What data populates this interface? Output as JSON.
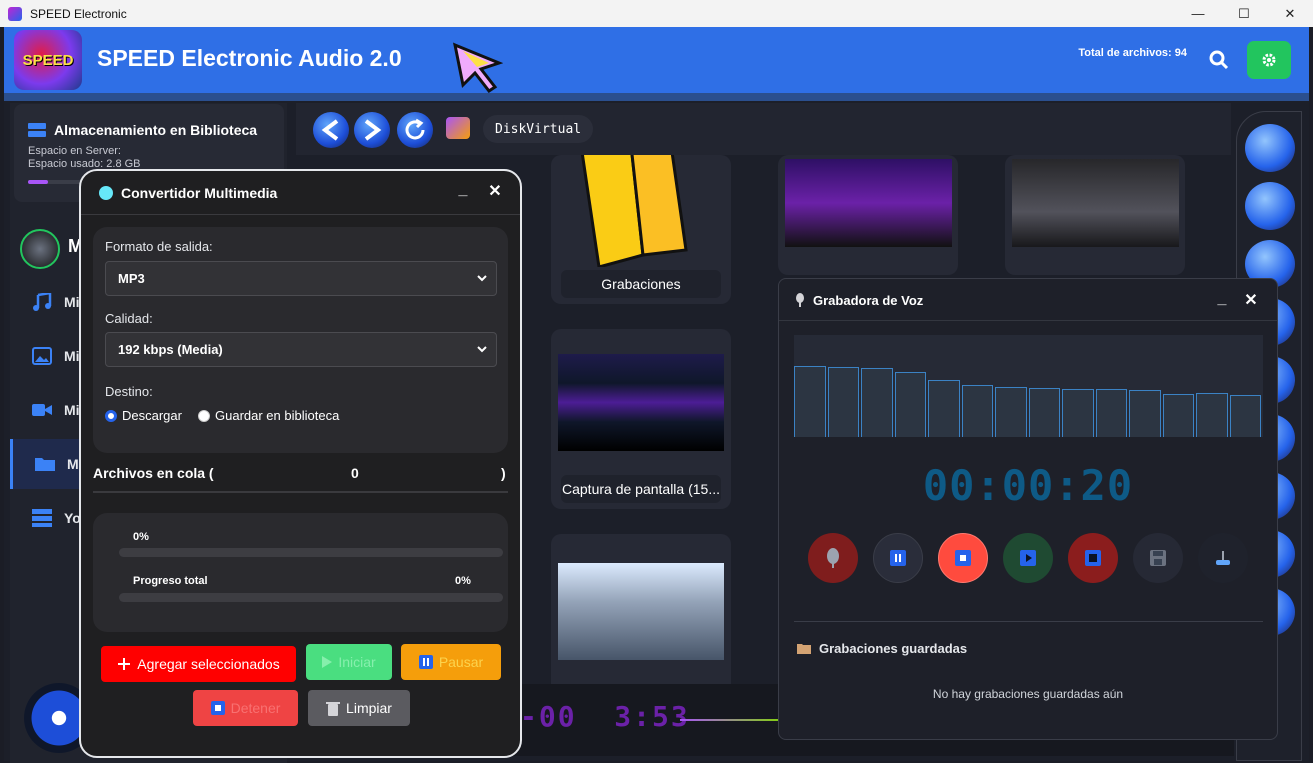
{
  "window": {
    "title": "SPEED Electronic",
    "minimize": "—",
    "maximize": "☐",
    "close": "✕"
  },
  "header": {
    "logo_text": "SPEED",
    "title": "SPEED Electronic Audio 2.0",
    "total_files": "Total de archivos: 94"
  },
  "sidebar": {
    "storage_title": "Almacenamiento en Biblioteca",
    "server_space": "Espacio en Server:",
    "used_space": "Espacio usado: 2.8 GB",
    "storage_fill": 0.08,
    "user_initial": "M",
    "items": [
      {
        "label": "Mi",
        "icon": "music-icon"
      },
      {
        "label": "Mi",
        "icon": "image-icon"
      },
      {
        "label": "Mi",
        "icon": "video-icon"
      },
      {
        "label": "Mi",
        "icon": "folder-icon"
      },
      {
        "label": "Yo",
        "icon": "server-icon"
      }
    ]
  },
  "toolbar": {
    "path": "DiskVirtual"
  },
  "grid": {
    "cards": [
      "Grabaciones",
      "Captura de pantalla (15..."
    ]
  },
  "player": {
    "time_left": "-00",
    "time_right": "3:53"
  },
  "converter": {
    "title": "Convertidor Multimedia",
    "min": "_",
    "close": "✕",
    "format_label": "Formato de salida:",
    "format_value": "MP3",
    "quality_label": "Calidad:",
    "quality_value": "192 kbps (Media)",
    "dest_label": "Destino:",
    "dest_download": "Descargar",
    "dest_library": "Guardar en biblioteca",
    "queue_label": "Archivos en cola (",
    "queue_count": "0",
    "queue_close": ")",
    "file_progress_text": "0%",
    "file_progress": 0,
    "total_label": "Progreso total",
    "total_progress_text": "0%",
    "total_progress": 0,
    "btn_add": "Agregar seleccionados",
    "btn_start": "Iniciar",
    "btn_pause": "Pausar",
    "btn_stop": "Detener",
    "btn_clear": "Limpiar"
  },
  "recorder": {
    "title": "Grabadora de Voz",
    "min": "_",
    "close": "✕",
    "timer": "00:00:20",
    "levels": [
      0.7,
      0.69,
      0.68,
      0.64,
      0.56,
      0.51,
      0.49,
      0.48,
      0.47,
      0.47,
      0.46,
      0.42,
      0.43,
      0.41
    ],
    "saved_title": "Grabaciones guardadas",
    "saved_empty": "No hay grabaciones guardadas aún"
  }
}
